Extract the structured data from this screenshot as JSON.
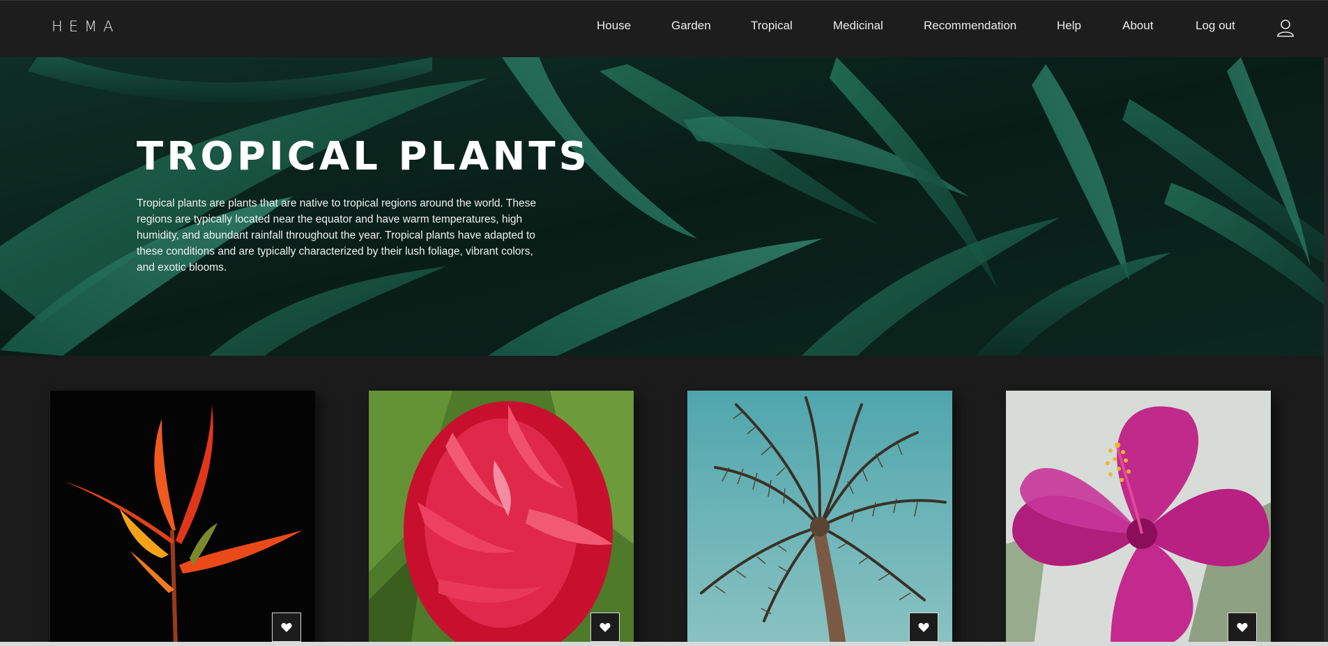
{
  "brand": {
    "logo": "HEMA"
  },
  "nav": {
    "items": [
      {
        "label": "House"
      },
      {
        "label": "Garden"
      },
      {
        "label": "Tropical"
      },
      {
        "label": "Medicinal"
      },
      {
        "label": "Recommendation"
      },
      {
        "label": "Help"
      },
      {
        "label": "About"
      },
      {
        "label": "Log out"
      }
    ],
    "user_icon": "user-icon"
  },
  "hero": {
    "title": "TROPICAL PLANTS",
    "description": "Tropical plants are plants that are native to tropical regions around the world. These regions are typically located near the equator and have warm temperatures, high humidity, and abundant rainfall throughout the year. Tropical plants have adapted to these conditions and are typically characterized by their lush foliage, vibrant colors, and exotic blooms."
  },
  "cards": [
    {
      "image": "bird-of-paradise-image",
      "favorite_icon": "heart-icon"
    },
    {
      "image": "red-ginger-image",
      "favorite_icon": "heart-icon"
    },
    {
      "image": "palm-tree-image",
      "favorite_icon": "heart-icon"
    },
    {
      "image": "hibiscus-image",
      "favorite_icon": "heart-icon"
    }
  ],
  "colors": {
    "background": "#1b1b1b",
    "navbar": "#1d1d1d",
    "hero_green": "#1f6b53",
    "text": "#ececec"
  }
}
